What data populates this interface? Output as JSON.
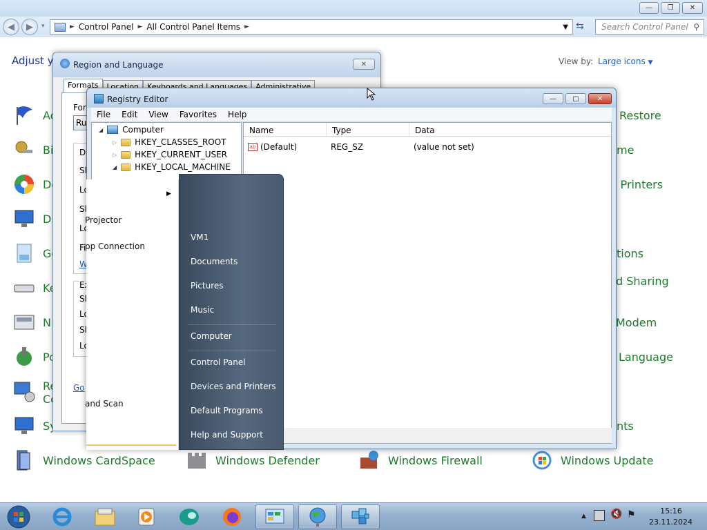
{
  "control_panel": {
    "window_buttons": [
      "minimize",
      "maximize",
      "close"
    ],
    "breadcrumb": [
      "Control Panel",
      "All Control Panel Items"
    ],
    "search_placeholder": "Search Control Panel",
    "heading": "Adjust y",
    "view_by_label": "View by:",
    "view_by_value": "Large icons",
    "items_left": [
      {
        "label": "Ac",
        "icon": "action-center-flag-icon"
      },
      {
        "label": "Bi",
        "icon": "bitlocker-keys-icon"
      },
      {
        "label": "De",
        "icon": "default-programs-icon"
      },
      {
        "label": "Di",
        "icon": "display-monitor-icon"
      },
      {
        "label": "Ge",
        "icon": "gadgets-icon"
      },
      {
        "label": "Ke",
        "icon": "keyboard-icon"
      },
      {
        "label": "N",
        "icon": "network-icon"
      },
      {
        "label": "Po",
        "icon": "power-options-icon"
      },
      {
        "label": "Re\nCo",
        "icon": "remoteapp-icon"
      },
      {
        "label": "Sy",
        "icon": "system-icon"
      }
    ],
    "items_right": [
      {
        "label": "Restore"
      },
      {
        "label": "me"
      },
      {
        "label": "l Printers"
      },
      {
        "label": "tions"
      },
      {
        "label": "d Sharing"
      },
      {
        "label": "Modem"
      },
      {
        "label": "Language"
      },
      {
        "label": "nts"
      }
    ],
    "items_bottom": [
      {
        "label": "Windows CardSpace",
        "icon": "cardspace-icon"
      },
      {
        "label": "Windows Defender",
        "icon": "defender-castle-icon"
      },
      {
        "label": "Windows Firewall",
        "icon": "firewall-icon"
      },
      {
        "label": "Windows Update",
        "icon": "windows-update-icon"
      }
    ]
  },
  "region_dialog": {
    "title": "Region and Language",
    "tabs": [
      "Formats",
      "Location",
      "Keyboards and Languages",
      "Administrative"
    ],
    "format_label": "Forr",
    "format_value": "Rus",
    "section1_label": "Da",
    "rows1": [
      "Sh",
      "Lo",
      "Sh",
      "Lo",
      "Fir"
    ],
    "link1": "W",
    "section2_label": "Ex",
    "rows2": [
      "Sh",
      "Lo",
      "Sh",
      "Lo"
    ],
    "link2": "Go"
  },
  "registry_editor": {
    "title": "Registry Editor",
    "menu": [
      "File",
      "Edit",
      "View",
      "Favorites",
      "Help"
    ],
    "tree": {
      "root": "Computer",
      "keys": [
        "HKEY_CLASSES_ROOT",
        "HKEY_CURRENT_USER",
        "HKEY_LOCAL_MACHINE"
      ]
    },
    "columns": [
      "Name",
      "Type",
      "Data"
    ],
    "rows": [
      {
        "name": "(Default)",
        "type": "REG_SZ",
        "data": "(value not set)"
      }
    ]
  },
  "start_menu": {
    "left_items": [
      "Projector",
      "pp Connection",
      "and Scan"
    ],
    "right_items": [
      "VM1",
      "Documents",
      "Pictures",
      "Music",
      "Computer",
      "Control Panel",
      "Devices and Printers",
      "Default Programs",
      "Help and Support"
    ]
  },
  "taskbar": {
    "buttons": [
      "start-orb-icon",
      "internet-explorer-icon",
      "explorer-folder-icon",
      "media-player-icon",
      "teal-app-icon",
      "firefox-icon",
      "control-panel-icon",
      "region-globe-icon",
      "registry-editor-icon"
    ],
    "tray_icons": [
      "show-hidden-icons-icon",
      "network-tray-icon",
      "volume-muted-icon",
      "action-center-flag-icon"
    ],
    "time": "15:16",
    "date": "23.11.2024"
  }
}
